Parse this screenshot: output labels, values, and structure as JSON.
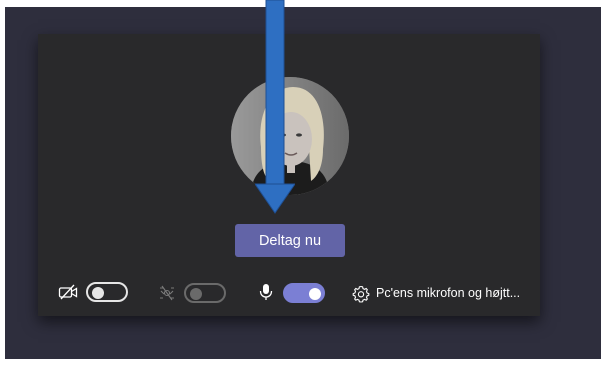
{
  "join_button": {
    "label": "Deltag nu"
  },
  "controls": {
    "camera": {
      "icon": "camera-off-icon",
      "state": "off"
    },
    "background_effects": {
      "icon": "background-blur-icon",
      "state": "off"
    },
    "microphone": {
      "icon": "microphone-icon",
      "state": "on"
    },
    "device_settings": {
      "icon": "gear-icon",
      "label": "Pc'ens mikrofon og højtt..."
    }
  },
  "colors": {
    "accent": "#6264a7",
    "toggle_on": "#7b7fd4",
    "arrow": "#2e6fc2"
  }
}
